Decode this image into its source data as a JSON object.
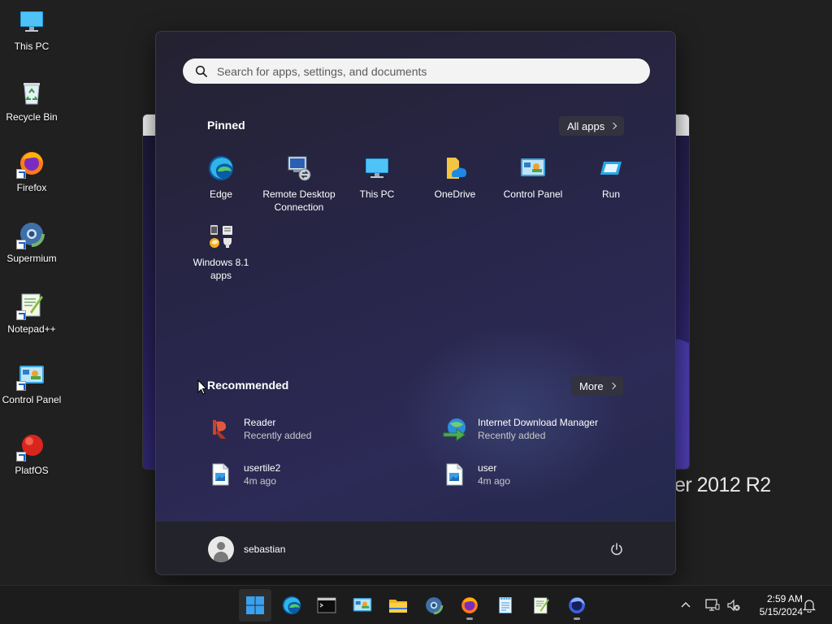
{
  "desktop": {
    "icons": [
      {
        "label": "This PC",
        "icon": "this-pc-icon"
      },
      {
        "label": "Recycle Bin",
        "icon": "recycle-bin-icon"
      },
      {
        "label": "Firefox",
        "icon": "firefox-icon"
      },
      {
        "label": "Supermium",
        "icon": "supermium-icon"
      },
      {
        "label": "Notepad++",
        "icon": "notepadpp-icon"
      },
      {
        "label": "Control Panel",
        "icon": "control-panel-icon"
      },
      {
        "label": "PlatfOS",
        "icon": "platfos-icon"
      }
    ],
    "background_window_text": "ver 2012 R2"
  },
  "start_menu": {
    "search_placeholder": "Search for apps, settings, and documents",
    "pinned_title": "Pinned",
    "all_apps_label": "All apps",
    "pinned": [
      {
        "label": "Edge",
        "icon": "edge-icon"
      },
      {
        "label": "Remote Desktop Connection",
        "icon": "remote-desktop-icon"
      },
      {
        "label": "This PC",
        "icon": "this-pc-icon"
      },
      {
        "label": "OneDrive",
        "icon": "onedrive-icon"
      },
      {
        "label": "Control Panel",
        "icon": "control-panel-icon"
      },
      {
        "label": "Run",
        "icon": "run-icon"
      },
      {
        "label": "Windows 8.1 apps",
        "icon": "windows-81-apps-icon"
      }
    ],
    "recommended_title": "Recommended",
    "more_label": "More",
    "recommended": [
      {
        "name": "Reader",
        "sub": "Recently added",
        "icon": "reader-icon"
      },
      {
        "name": "Internet Download Manager",
        "sub": "Recently added",
        "icon": "idm-icon"
      },
      {
        "name": "usertile2",
        "sub": "4m ago",
        "icon": "image-file-icon"
      },
      {
        "name": "user",
        "sub": "4m ago",
        "icon": "image-file-icon"
      }
    ],
    "user_name": "sebastian"
  },
  "taskbar": {
    "apps": [
      {
        "name": "start",
        "icon": "windows-start-icon",
        "active": true
      },
      {
        "name": "edge",
        "icon": "edge-icon"
      },
      {
        "name": "terminal",
        "icon": "terminal-icon"
      },
      {
        "name": "control-panel",
        "icon": "control-panel-icon"
      },
      {
        "name": "file-explorer",
        "icon": "folder-icon"
      },
      {
        "name": "supermium",
        "icon": "supermium-icon"
      },
      {
        "name": "firefox",
        "icon": "firefox-icon",
        "running": true
      },
      {
        "name": "notepad",
        "icon": "notepad-icon"
      },
      {
        "name": "notepadpp",
        "icon": "notepadpp-icon"
      },
      {
        "name": "firefox-nightly",
        "icon": "firefox-nightly-icon",
        "running": true
      }
    ],
    "time": "2:59 AM",
    "date": "5/15/2024"
  },
  "colors": {
    "accent": "#0078d4",
    "start_bg": "#272540",
    "taskbar_bg": "#1c1c1c"
  }
}
